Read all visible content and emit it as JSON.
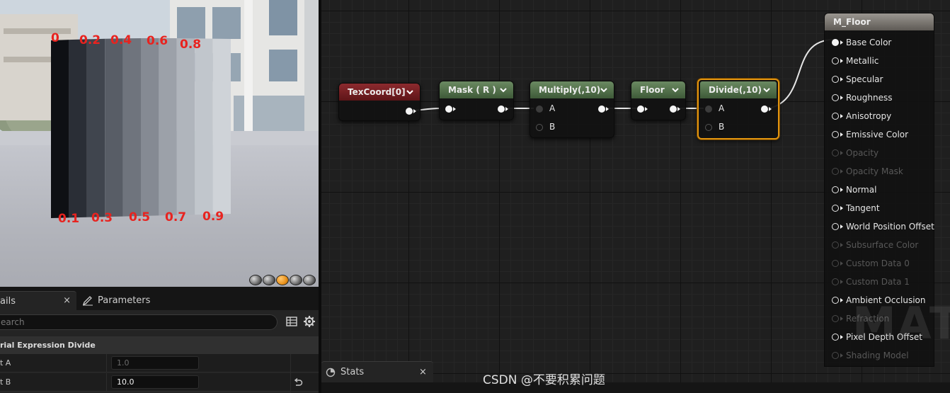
{
  "viewport": {
    "top_labels": [
      "0",
      "0.2",
      "0.4",
      "0.6",
      "0.8"
    ],
    "bottom_labels": [
      "0.1",
      "0.3",
      "0.5",
      "0.7",
      "0.9"
    ],
    "stripe_colors": [
      "#0e1014",
      "#2a2e36",
      "#40454e",
      "#585d66",
      "#6f747d",
      "#858a93",
      "#9ca1a9",
      "#b0b5bc",
      "#c1c6cc",
      "#cfd3d8"
    ],
    "preview_shapes": [
      "cylinder",
      "sphere",
      "plane",
      "cube",
      "custom-mesh"
    ],
    "active_shape": "plane"
  },
  "details": {
    "tab_details_label": "ails",
    "tab_close": "×",
    "tab_params_label": "Parameters",
    "search_placeholder": "earch",
    "category": "rial Expression Divide",
    "properties": [
      {
        "name": "t A",
        "value": "1.0"
      },
      {
        "name": "t B",
        "value": "10.0"
      }
    ]
  },
  "graph": {
    "nodes": [
      {
        "title": "TexCoord[0]",
        "color": "red"
      },
      {
        "title": "Mask ( R )",
        "color": "green"
      },
      {
        "title": "Multiply(,10)",
        "color": "green",
        "inputs": [
          "A",
          "B"
        ]
      },
      {
        "title": "Floor",
        "color": "green"
      },
      {
        "title": "Divide(,10)",
        "color": "green",
        "inputs": [
          "A",
          "B"
        ],
        "selected": true
      }
    ],
    "selected_color": "#e3950f",
    "result": {
      "title": "M_Floor",
      "pins": [
        {
          "label": "Base Color",
          "connected": true,
          "enabled": true
        },
        {
          "label": "Metallic",
          "connected": false,
          "enabled": true
        },
        {
          "label": "Specular",
          "connected": false,
          "enabled": true
        },
        {
          "label": "Roughness",
          "connected": false,
          "enabled": true
        },
        {
          "label": "Anisotropy",
          "connected": false,
          "enabled": true
        },
        {
          "label": "Emissive Color",
          "connected": false,
          "enabled": true
        },
        {
          "label": "Opacity",
          "connected": false,
          "enabled": false
        },
        {
          "label": "Opacity Mask",
          "connected": false,
          "enabled": false
        },
        {
          "label": "Normal",
          "connected": false,
          "enabled": true
        },
        {
          "label": "Tangent",
          "connected": false,
          "enabled": true
        },
        {
          "label": "World Position Offset",
          "connected": false,
          "enabled": true
        },
        {
          "label": "Subsurface Color",
          "connected": false,
          "enabled": false
        },
        {
          "label": "Custom Data 0",
          "connected": false,
          "enabled": false
        },
        {
          "label": "Custom Data 1",
          "connected": false,
          "enabled": false
        },
        {
          "label": "Ambient Occlusion",
          "connected": false,
          "enabled": true
        },
        {
          "label": "Refraction",
          "connected": false,
          "enabled": false
        },
        {
          "label": "Pixel Depth Offset",
          "connected": false,
          "enabled": true
        },
        {
          "label": "Shading Model",
          "connected": false,
          "enabled": false
        }
      ]
    },
    "watermark": "MATE",
    "stats_tab": "Stats",
    "stats_close": "×"
  },
  "footer_watermark": "CSDN @不要积累问题"
}
